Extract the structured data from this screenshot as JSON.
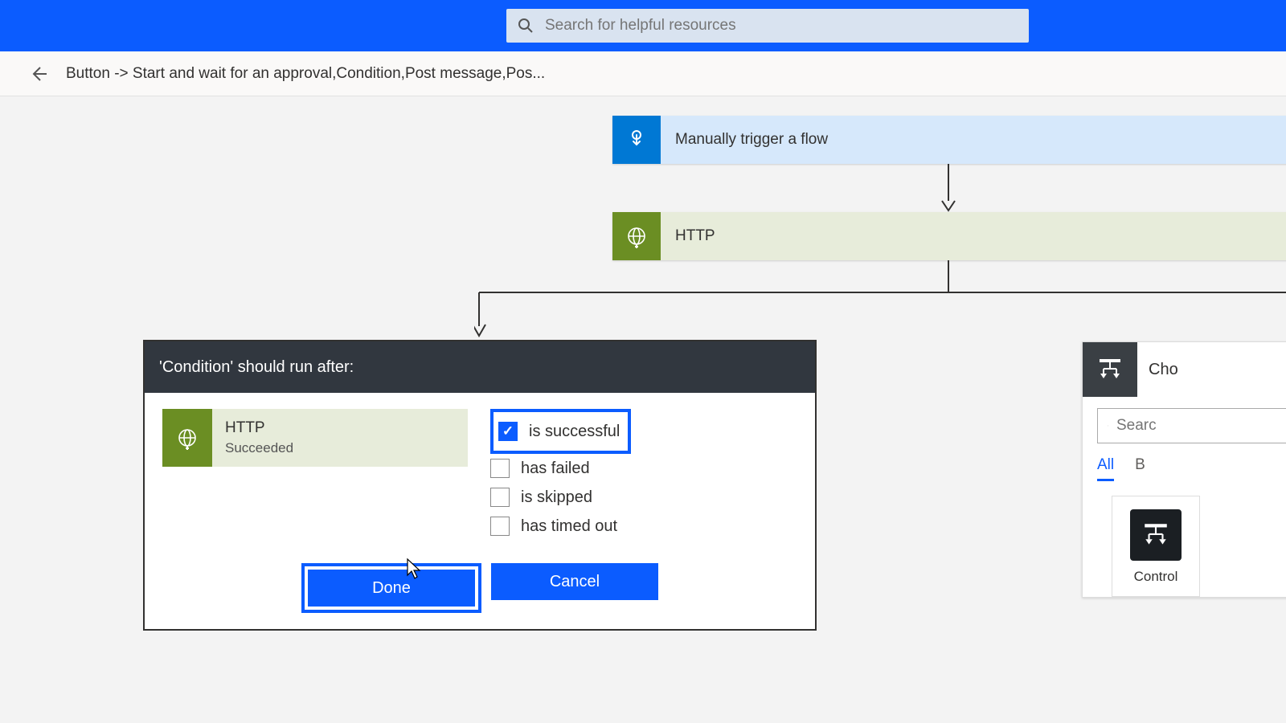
{
  "search": {
    "placeholder": "Search for helpful resources"
  },
  "breadcrumb": "Button -> Start and wait for an approval,Condition,Post message,Pos...",
  "flow": {
    "trigger": {
      "label": "Manually trigger a flow"
    },
    "http": {
      "label": "HTTP"
    }
  },
  "runAfter": {
    "title": "'Condition' should run after:",
    "step": {
      "name": "HTTP",
      "status": "Succeeded"
    },
    "options": {
      "successful": {
        "label": "is successful",
        "checked": true
      },
      "failed": {
        "label": "has failed",
        "checked": false
      },
      "skipped": {
        "label": "is skipped",
        "checked": false
      },
      "timedout": {
        "label": "has timed out",
        "checked": false
      }
    },
    "done": "Done",
    "cancel": "Cancel"
  },
  "chooser": {
    "title": "Cho",
    "search_placeholder": "Searc",
    "tabs": {
      "all": "All",
      "b": "B"
    },
    "card": {
      "label": "Control"
    }
  }
}
